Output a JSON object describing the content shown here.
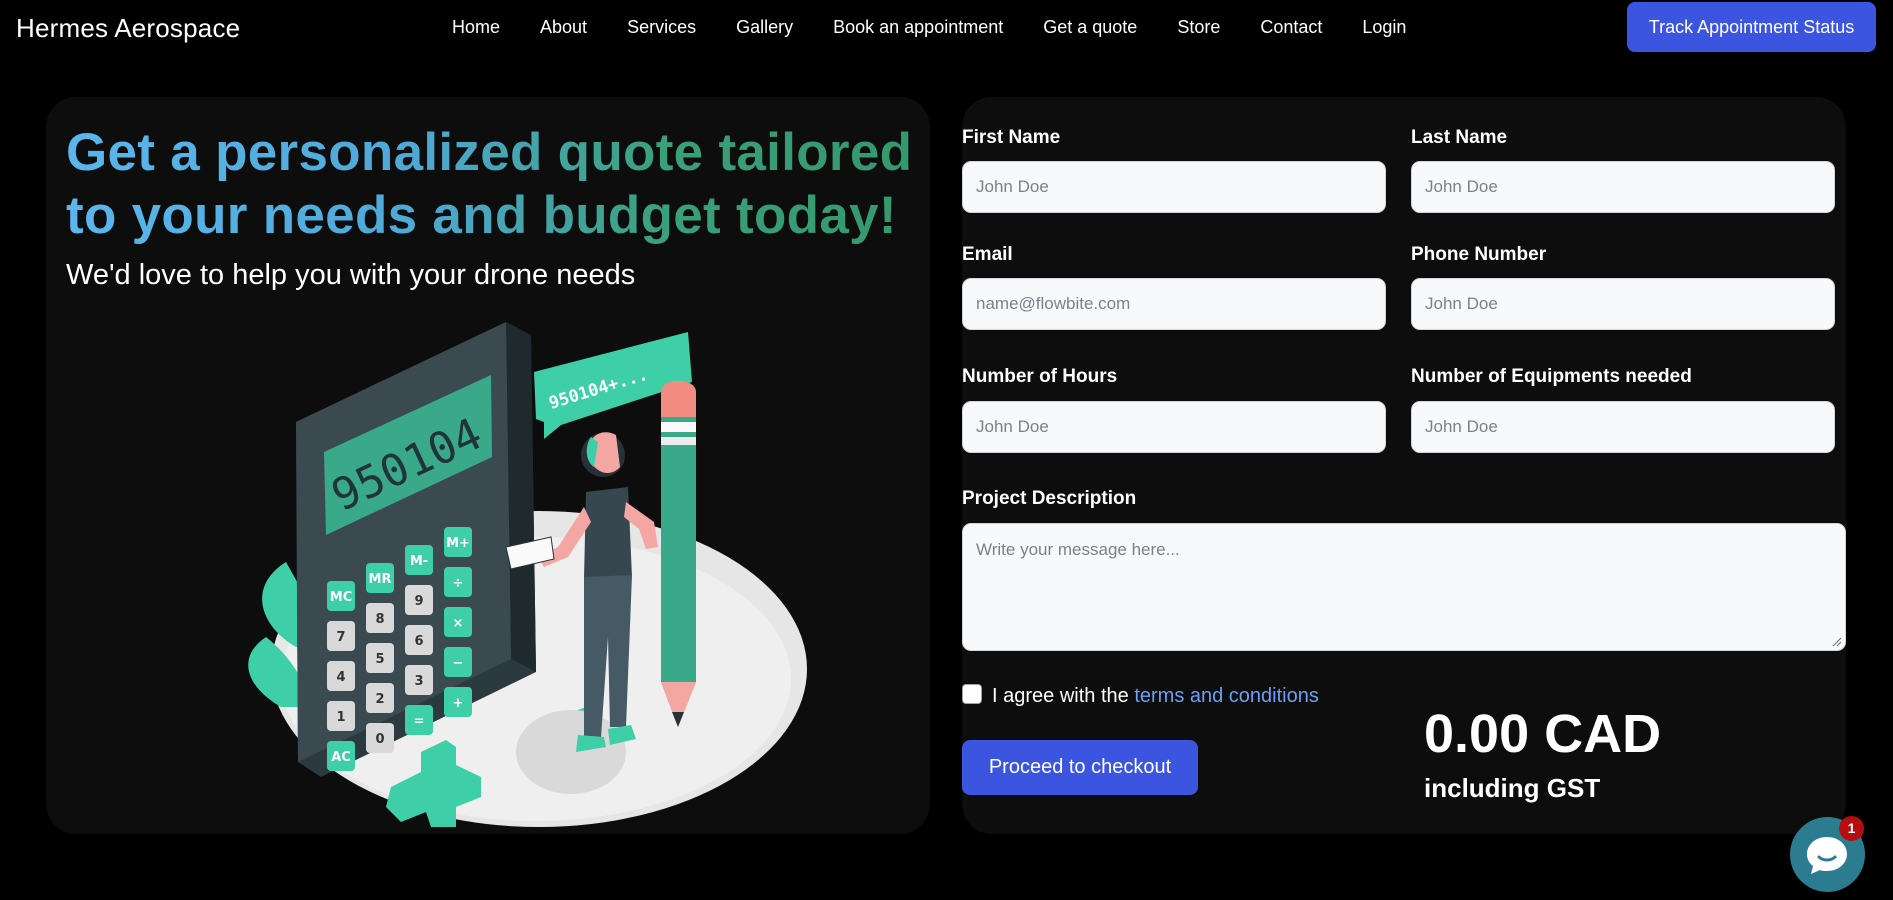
{
  "nav": {
    "brand": "Hermes Aerospace",
    "links": [
      "Home",
      "About",
      "Services",
      "Gallery",
      "Book an appointment",
      "Get a quote",
      "Store",
      "Contact",
      "Login"
    ],
    "cta": "Track Appointment Status"
  },
  "hero": {
    "headline": "Get a personalized quote tailored to your needs and budget today!",
    "subhead": "We'd love to help you with your drone needs",
    "calculator_display": "950104",
    "speech_bubble": "950104+...",
    "keys": [
      "MC",
      "MR",
      "M-",
      "M+",
      "7",
      "8",
      "9",
      "÷",
      "4",
      "5",
      "6",
      "×",
      "1",
      "2",
      "3",
      "−",
      "AC",
      "0",
      "=",
      "+"
    ]
  },
  "form": {
    "first_name": {
      "label": "First Name",
      "placeholder": "John Doe"
    },
    "last_name": {
      "label": "Last Name",
      "placeholder": "John Doe"
    },
    "email": {
      "label": "Email",
      "placeholder": "name@flowbite.com"
    },
    "phone": {
      "label": "Phone Number",
      "placeholder": "John Doe"
    },
    "hours": {
      "label": "Number of Hours",
      "placeholder": "John Doe"
    },
    "equipments": {
      "label": "Number of Equipments needed",
      "placeholder": "John Doe"
    },
    "description": {
      "label": "Project Description",
      "placeholder": "Write your message here..."
    },
    "agree_prefix": "I agree with the ",
    "terms_link": "terms and conditions",
    "checkout": "Proceed to checkout",
    "price": "0.00 CAD",
    "price_note": "including GST"
  },
  "chat": {
    "badge_count": "1"
  },
  "colors": {
    "accent": "#3b55e0",
    "headline_start": "#5bb6ee",
    "headline_end": "#34986c",
    "link": "#6b9ff5",
    "teal": "#3ecfa8"
  }
}
